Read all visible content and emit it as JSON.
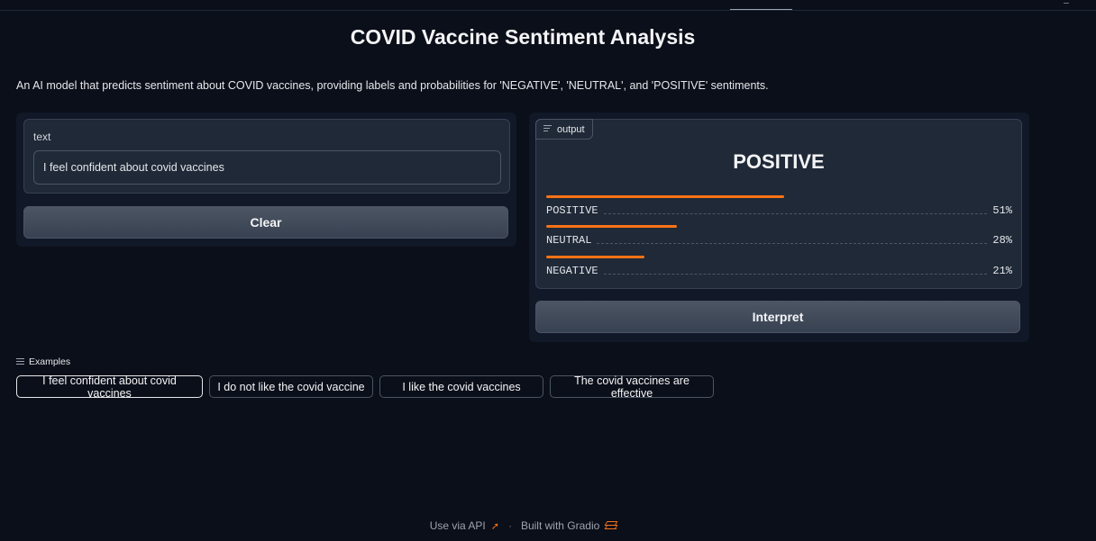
{
  "app": {
    "title": "COVID Vaccine Sentiment Analysis",
    "description": "An AI model that predicts sentiment about COVID vaccines, providing labels and probabilities for 'NEGATIVE', 'NEUTRAL', and 'POSITIVE' sentiments."
  },
  "input": {
    "label": "text",
    "value": "I feel confident about covid vaccines",
    "clear_label": "Clear"
  },
  "output": {
    "tag": "output",
    "predicted_label": "POSITIVE",
    "confidences": [
      {
        "label": "POSITIVE",
        "value_text": "51%",
        "fraction": 0.51
      },
      {
        "label": "NEUTRAL",
        "value_text": "28%",
        "fraction": 0.28
      },
      {
        "label": "NEGATIVE",
        "value_text": "21%",
        "fraction": 0.21
      }
    ],
    "interpret_label": "Interpret",
    "bar_color": "#f97316"
  },
  "examples": {
    "heading": "Examples",
    "items": [
      "I feel confident about covid vaccines",
      "I do not like the covid vaccine",
      "I like the covid vaccines",
      "The covid vaccines are effective"
    ]
  },
  "footer": {
    "api_label": "Use via API",
    "separator": "·",
    "built_with": "Built with Gradio"
  }
}
